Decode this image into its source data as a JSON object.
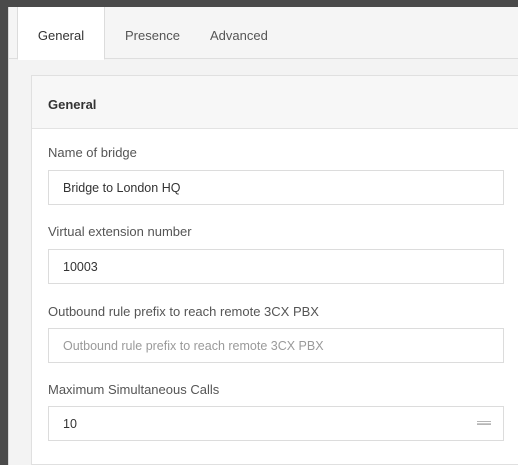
{
  "tabs": [
    {
      "label": "General",
      "active": true
    },
    {
      "label": "Presence",
      "active": false
    },
    {
      "label": "Advanced",
      "active": false
    }
  ],
  "panel": {
    "title": "General",
    "fields": {
      "bridge_name": {
        "label": "Name of bridge",
        "value": "Bridge to London HQ"
      },
      "virtual_extension": {
        "label": "Virtual extension number",
        "value": "10003"
      },
      "outbound_prefix": {
        "label": "Outbound rule prefix to reach remote 3CX PBX",
        "value": "",
        "placeholder": "Outbound rule prefix to reach remote 3CX PBX"
      },
      "max_calls": {
        "label": "Maximum Simultaneous Calls",
        "value": "10"
      }
    }
  },
  "colors": {
    "background": "#4a4a4a",
    "tabbar": "#f5f5f5",
    "panel_header": "#f7f7f7",
    "border": "#dcdcdc"
  }
}
